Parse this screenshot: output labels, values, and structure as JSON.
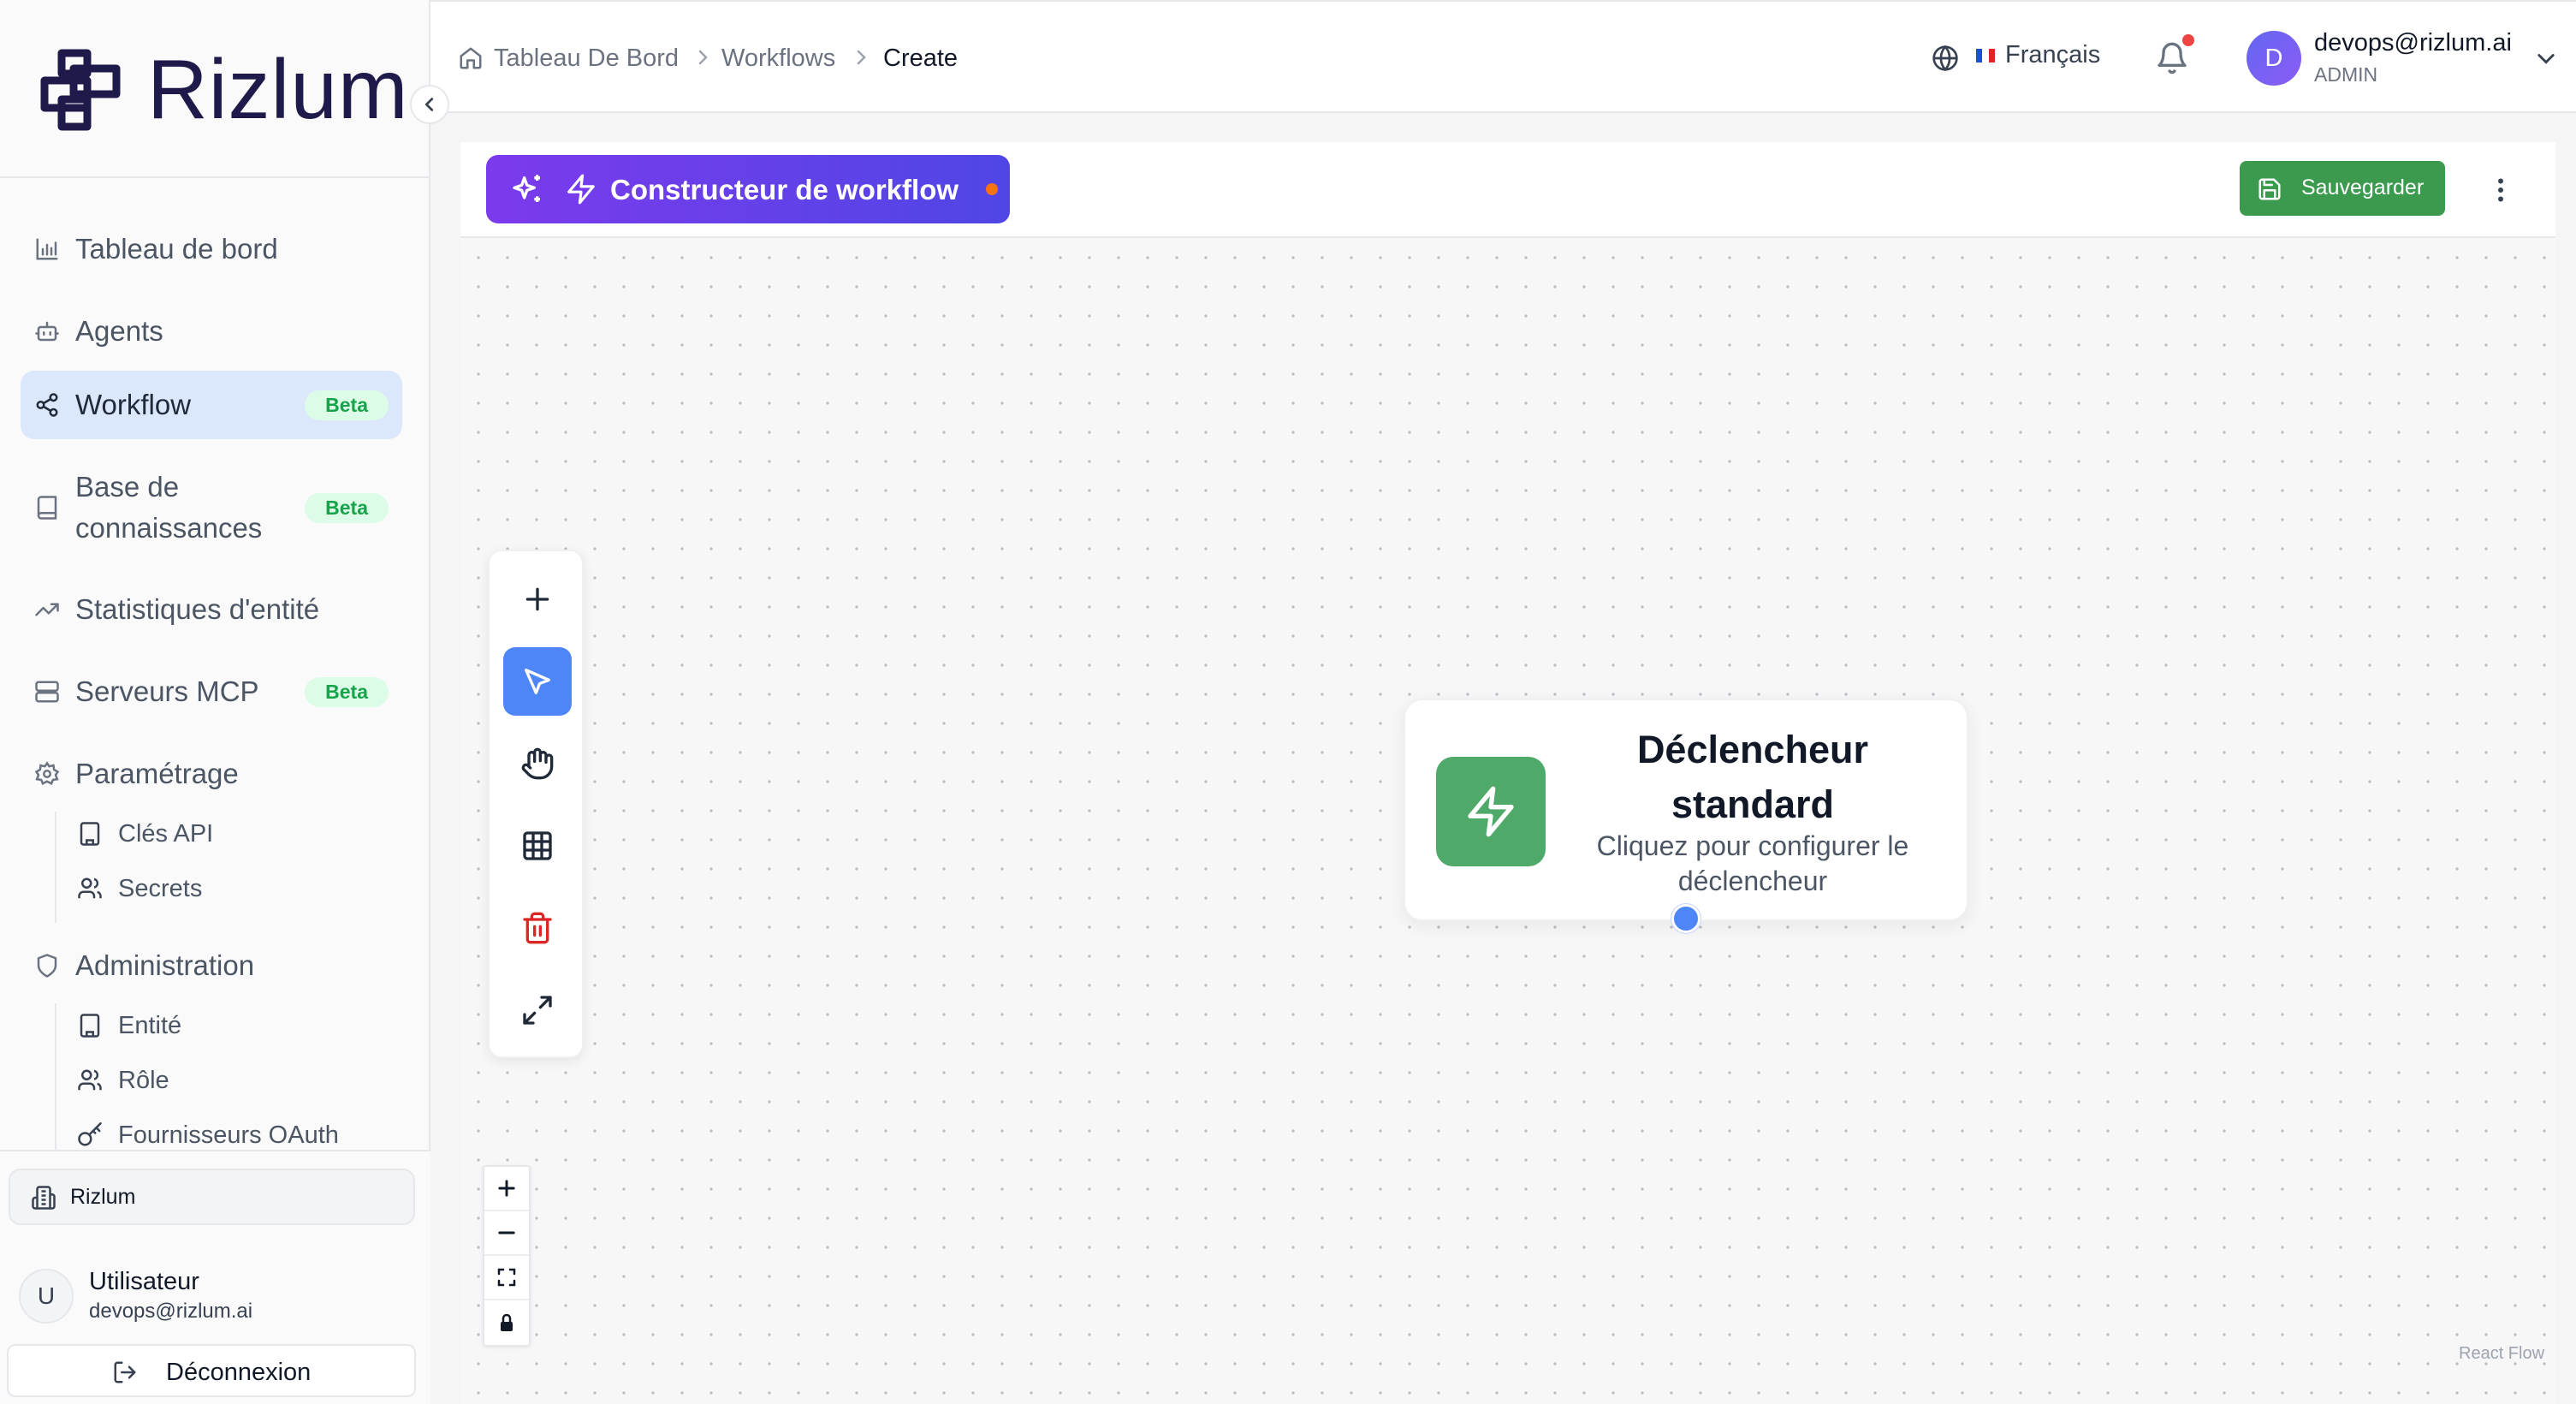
{
  "brand": {
    "name": "Rizlum"
  },
  "nav": {
    "items": [
      {
        "label": "Tableau de bord",
        "icon": "bar-chart-icon",
        "badge": ""
      },
      {
        "label": "Agents",
        "icon": "bot-icon",
        "badge": ""
      },
      {
        "label": "Workflow",
        "icon": "share-nodes-icon",
        "badge": "Beta",
        "active": true
      },
      {
        "label_line1": "Base de",
        "label_line2": "connaissances",
        "icon": "book-icon",
        "badge": "Beta"
      },
      {
        "label": "Statistiques d'entité",
        "icon": "trending-up-icon",
        "badge": ""
      },
      {
        "label": "Serveurs MCP",
        "icon": "server-icon",
        "badge": "Beta"
      },
      {
        "label": "Paramétrage",
        "icon": "gear-icon",
        "badge": ""
      },
      {
        "label": "Administration",
        "icon": "shield-icon",
        "badge": ""
      }
    ],
    "settings_children": [
      {
        "label": "Clés API",
        "icon": "building-icon"
      },
      {
        "label": "Secrets",
        "icon": "users-icon"
      }
    ],
    "admin_children": [
      {
        "label": "Entité",
        "icon": "building-icon"
      },
      {
        "label": "Rôle",
        "icon": "users-icon"
      },
      {
        "label": "Fournisseurs OAuth",
        "icon": "key-icon"
      }
    ]
  },
  "footer": {
    "org": "Rizlum",
    "user_name": "Utilisateur",
    "user_initial": "U",
    "user_email": "devops@rizlum.ai",
    "logout": "Déconnexion"
  },
  "header": {
    "breadcrumb": [
      "Tableau De Bord",
      "Workflows",
      "Create"
    ],
    "language": "Français",
    "account_initial": "D",
    "account_email": "devops@rizlum.ai",
    "account_role": "ADMIN",
    "notification_dot": true
  },
  "workflow": {
    "title": "Constructeur de workflow",
    "unsaved_indicator_color": "#f97316",
    "save_label": "Sauvegarder",
    "tools": [
      "plus-icon",
      "pointer-icon",
      "hand-icon",
      "grid-icon",
      "trash-icon",
      "expand-icon"
    ],
    "active_tool": "pointer-icon",
    "node": {
      "title": "Déclencheur standard",
      "description": "Cliquez pour configurer le déclencheur",
      "icon": "lightning-icon"
    },
    "attribution": "React Flow"
  },
  "colors": {
    "accent": "#4f86f7",
    "brand_gradient_start": "#7c3aed",
    "brand_gradient_end": "#4f46e5",
    "save": "#3b9a4e",
    "node_icon": "#4faa6a",
    "beta_bg": "#dcfce7",
    "beta_text": "#16a34a"
  }
}
